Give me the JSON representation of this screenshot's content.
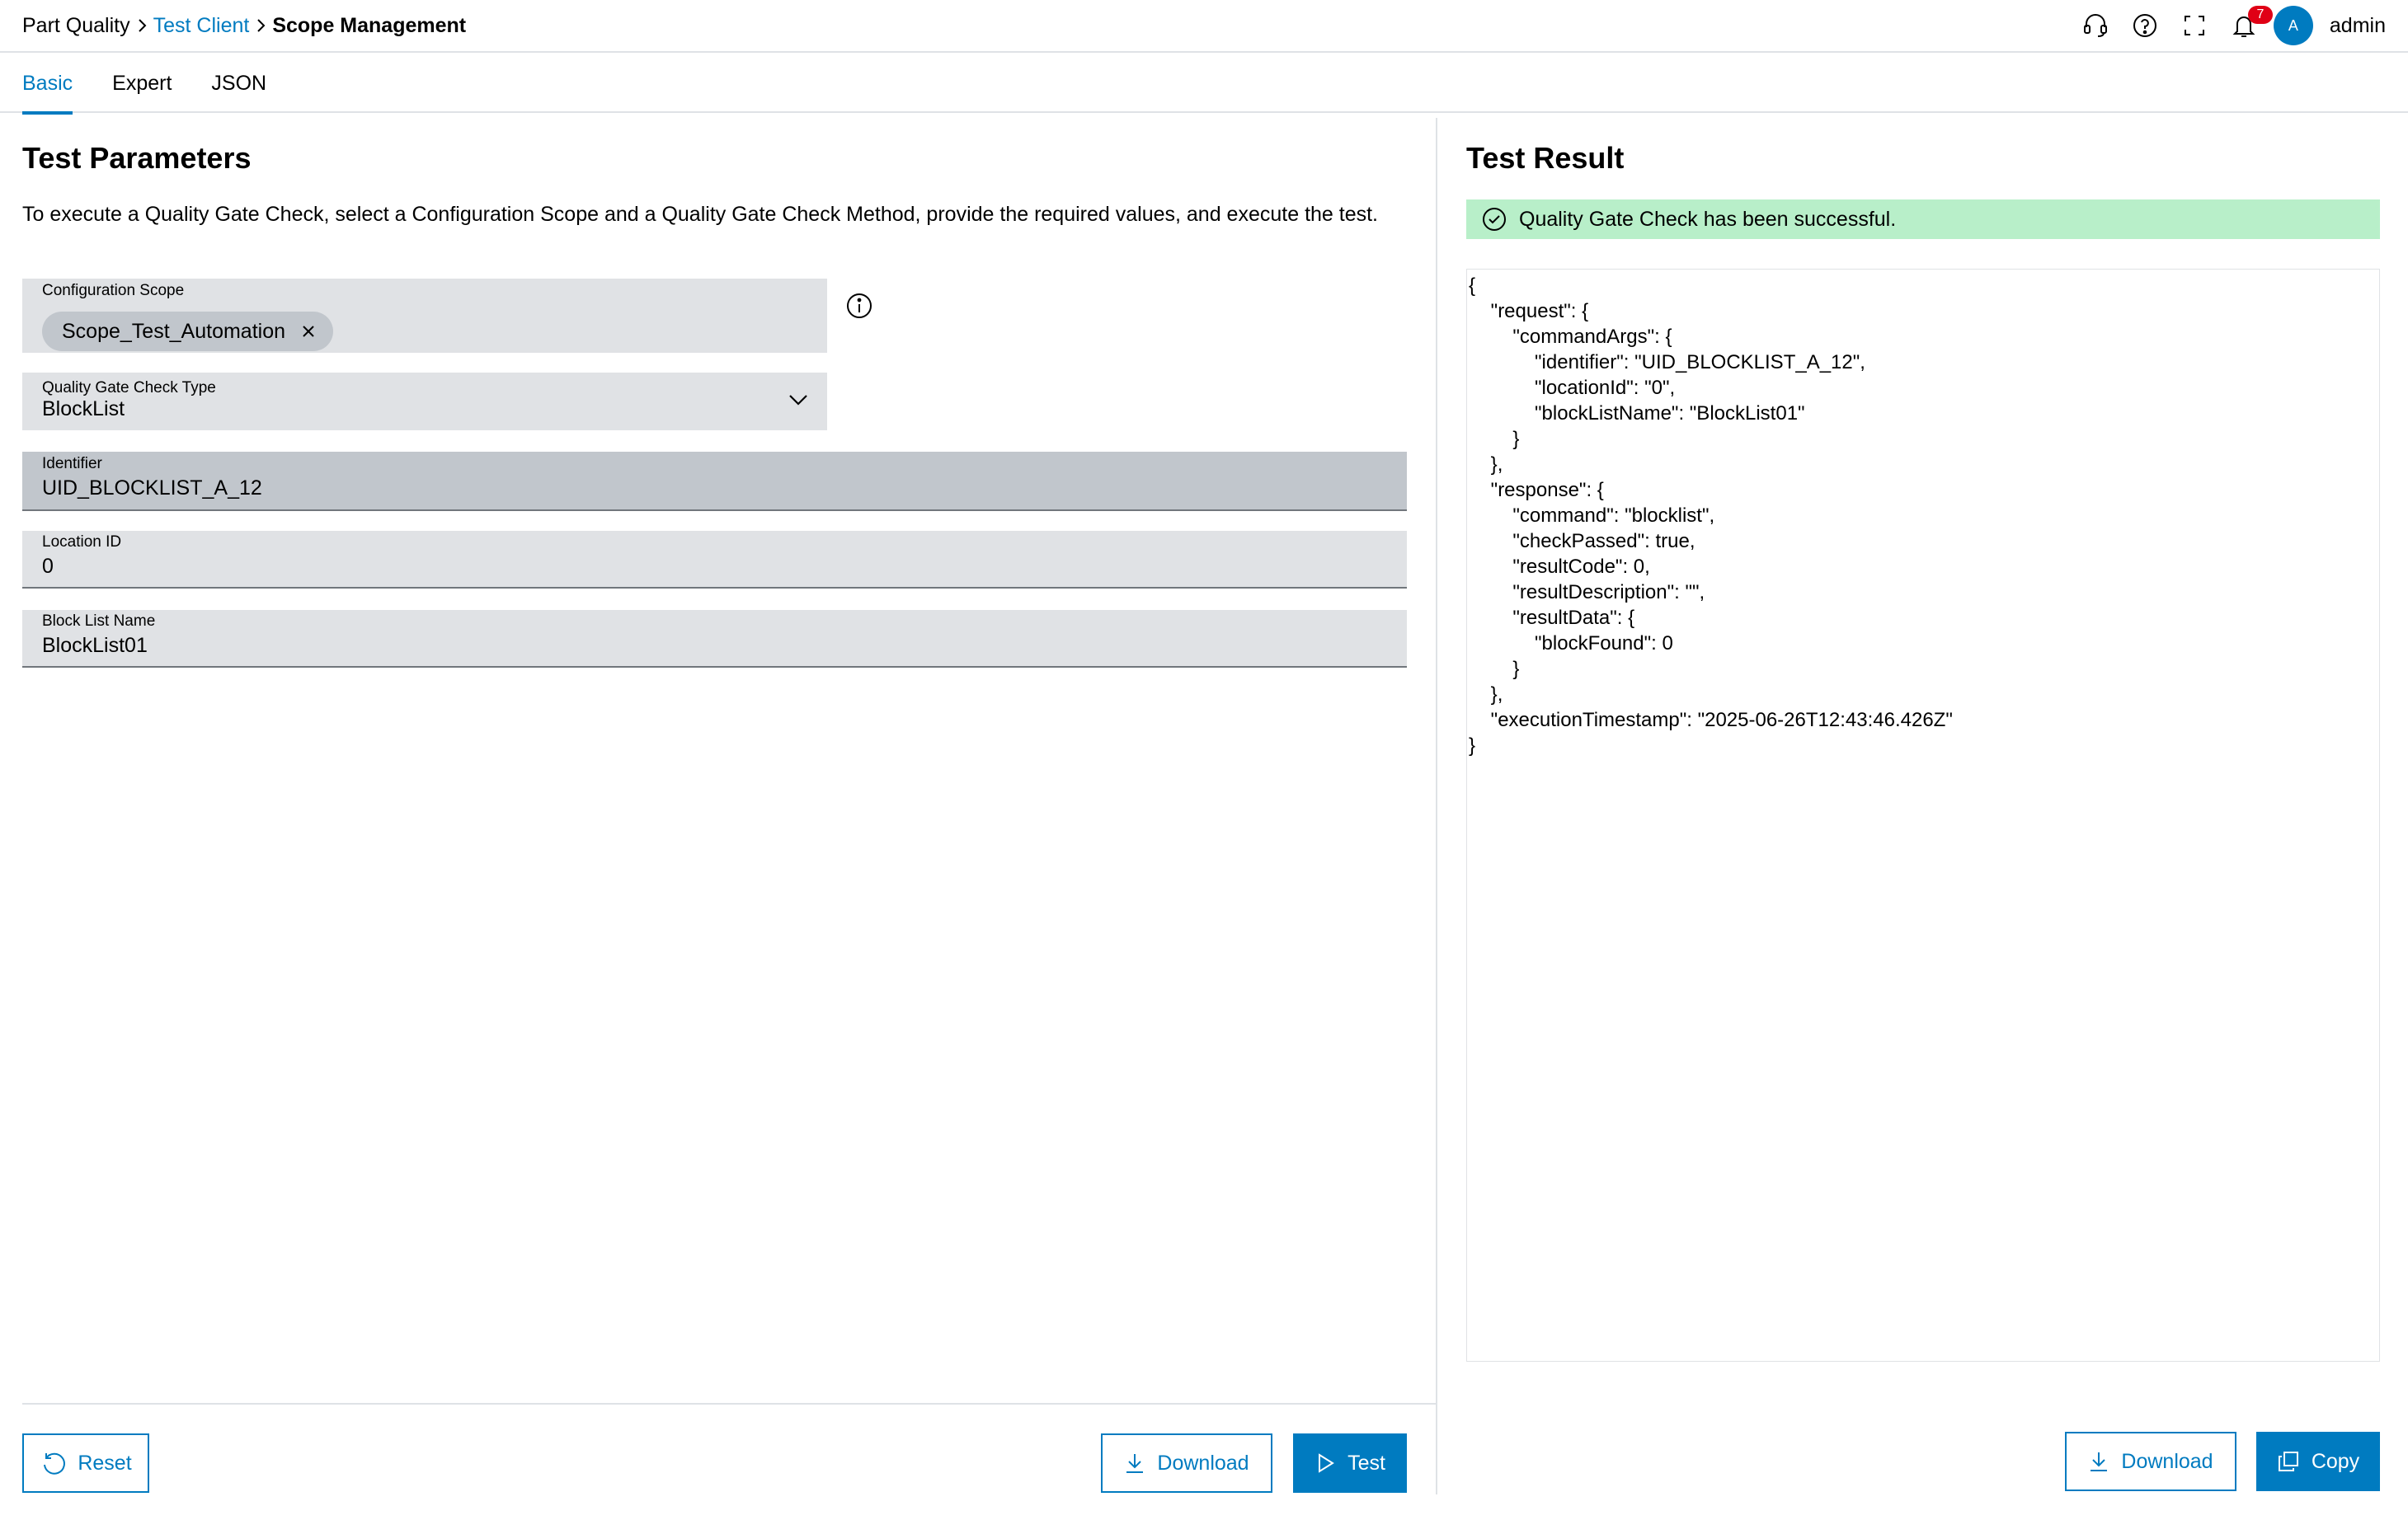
{
  "breadcrumb": {
    "root": "Part Quality",
    "parent": "Test Client",
    "current": "Scope Management"
  },
  "header": {
    "notification_count": "7",
    "avatar_initial": "A",
    "user_name": "admin",
    "icons": [
      "headset-icon",
      "help-icon",
      "fullscreen-icon",
      "bell-icon"
    ]
  },
  "tabs": [
    {
      "label": "Basic",
      "active": true
    },
    {
      "label": "Expert",
      "active": false
    },
    {
      "label": "JSON",
      "active": false
    }
  ],
  "params": {
    "title": "Test Parameters",
    "description": "To execute a Quality Gate Check, select a Configuration Scope and a Quality Gate Check Method, provide the required values, and execute the test.",
    "scope": {
      "label": "Configuration Scope",
      "chip": "Scope_Test_Automation"
    },
    "type": {
      "label": "Quality Gate Check Type",
      "value": "BlockList"
    },
    "identifier": {
      "label": "Identifier",
      "value": "UID_BLOCKLIST_A_12"
    },
    "location": {
      "label": "Location ID",
      "value": "0"
    },
    "blocklist": {
      "label": "Block List Name",
      "value": "BlockList01"
    }
  },
  "left_actions": {
    "reset": "Reset",
    "download": "Download",
    "test": "Test"
  },
  "result": {
    "title": "Test Result",
    "status": "Quality Gate Check has been successful.",
    "json": "{\n\t\"request\": {\n\t\t\"commandArgs\": {\n\t\t\t\"identifier\": \"UID_BLOCKLIST_A_12\",\n\t\t\t\"locationId\": \"0\",\n\t\t\t\"blockListName\": \"BlockList01\"\n\t\t}\n\t},\n\t\"response\": {\n\t\t\"command\": \"blocklist\",\n\t\t\"checkPassed\": true,\n\t\t\"resultCode\": 0,\n\t\t\"resultDescription\": \"\",\n\t\t\"resultData\": {\n\t\t\t\"blockFound\": 0\n\t\t}\n\t},\n\t\"executionTimestamp\": \"2025-06-26T12:43:46.426Z\"\n}"
  },
  "right_actions": {
    "download": "Download",
    "copy": "Copy"
  },
  "colors": {
    "accent": "#007bc0",
    "success_bg": "#b8efc9",
    "success_icon": "#00884a",
    "badge": "#e00015",
    "field_bg": "#e0e2e5"
  }
}
